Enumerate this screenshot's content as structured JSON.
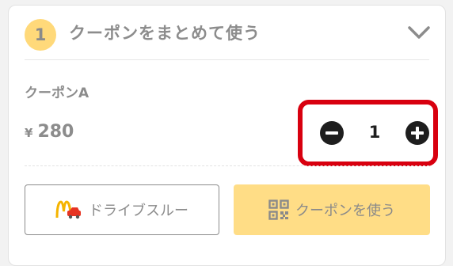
{
  "header": {
    "step_number": "1",
    "title": "クーポンをまとめて使う",
    "toggle_icon": "chevron-down-icon"
  },
  "coupon": {
    "name": "クーポンA",
    "currency_symbol": "¥",
    "price": "280"
  },
  "quantity": {
    "value": "1",
    "decrement_icon": "minus-circle-icon",
    "increment_icon": "plus-circle-icon"
  },
  "actions": {
    "drive_thru_label": "ドライブスルー",
    "drive_thru_icon": "mcdonalds-drive-thru-icon",
    "use_coupon_label": "クーポンを使う",
    "use_coupon_icon": "qr-code-icon"
  },
  "colors": {
    "badge": "#ffd97a",
    "primary_button": "#ffdd86",
    "highlight_border": "#d8000f",
    "text_muted": "#8c8c8c",
    "text_dark": "#1e1e1e"
  }
}
